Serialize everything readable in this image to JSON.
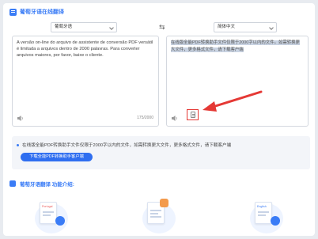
{
  "header": {
    "title": "葡萄牙语在线翻译"
  },
  "languages": {
    "source": "葡萄牙语",
    "target": "简体中文",
    "swap_glyph": "⇆"
  },
  "source": {
    "text": "A versão on-line do arquivo de assistente de conversão PDF versátil é limitada a arquivos dentro de 2000 palavras. Para converter arquivos maiores, por favor, baixe o cliente.",
    "counter": "175/2000"
  },
  "result": {
    "text": "在线版全能PDF转换助手文件仅限于2000字以内的文件。如需转换更大文件，更多格式文件，请下载客户端"
  },
  "notice": {
    "message": "在线版全能PDF转换助手文件仅限于2000字以内的文件，如需转换更大文件，更多格式文件，请下载客户端",
    "button_label": "下载全能PDF转换助手客户端"
  },
  "features": {
    "title": "葡萄牙语翻译 功能介绍:",
    "items": [
      {
        "icon": "portugal-doc-icon",
        "doc_label": "Portugal"
      },
      {
        "icon": "translate-doc-icon",
        "doc_label": ""
      },
      {
        "icon": "english-doc-icon",
        "doc_label": "English"
      }
    ]
  },
  "colors": {
    "accent": "#3a7cf6",
    "button": "#2f6ef0",
    "highlight": "#e53935"
  }
}
